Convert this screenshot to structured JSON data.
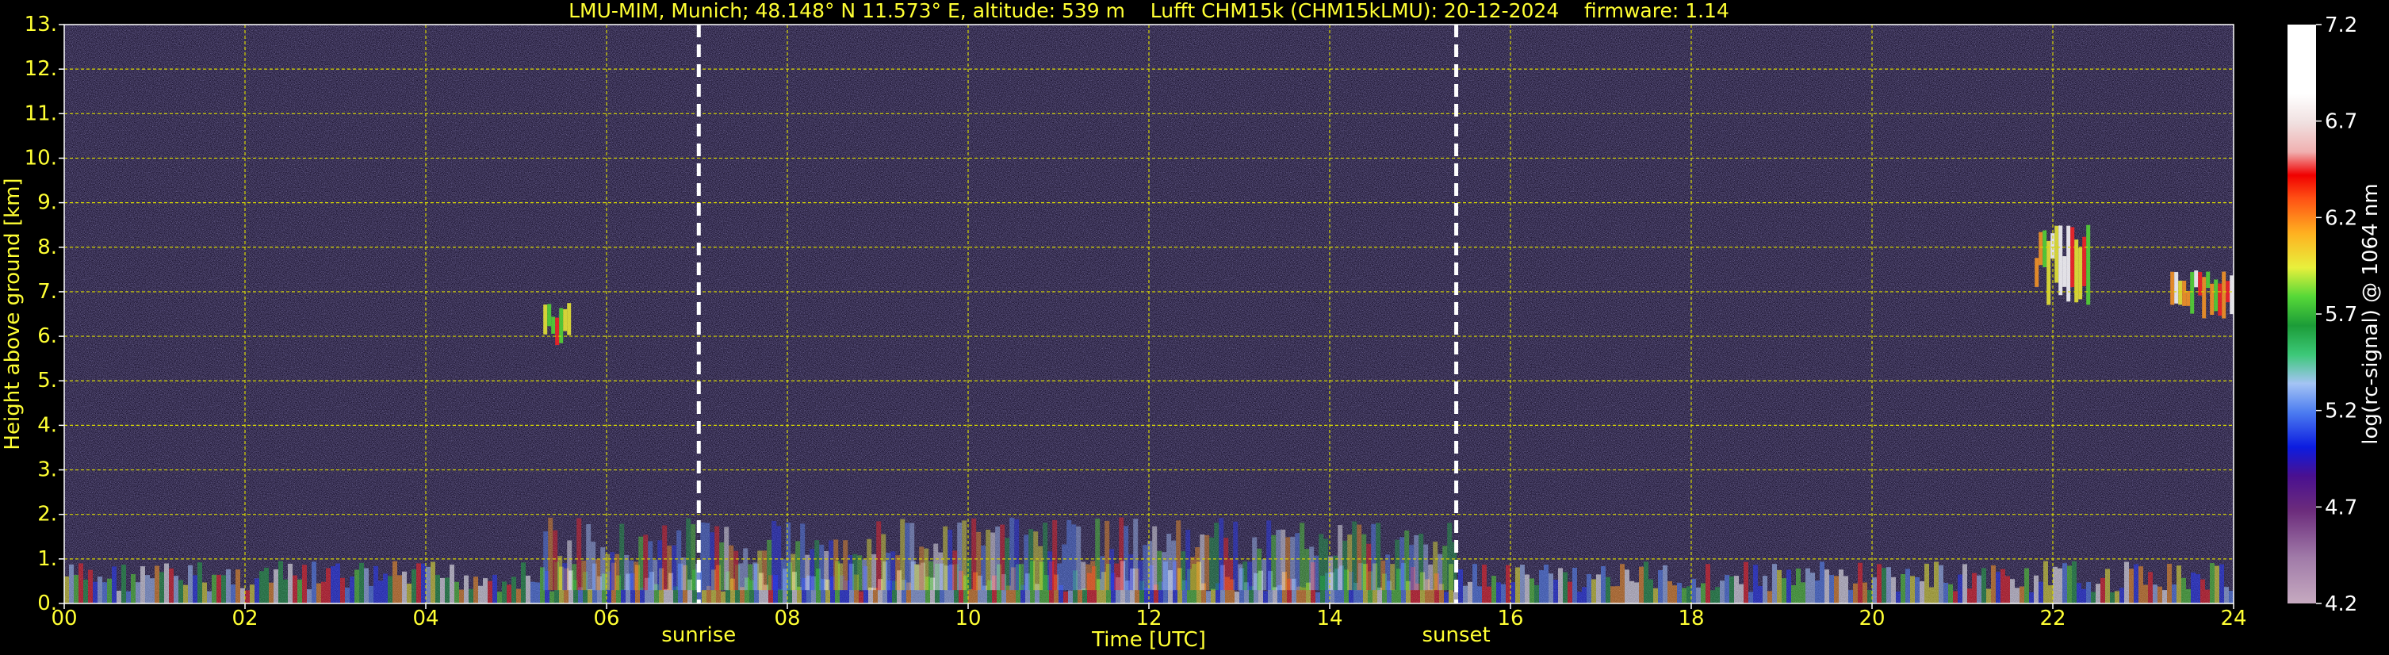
{
  "chart_data": {
    "type": "heatmap",
    "title": "LMU-MIM, Munich; 48.148° N 11.573° E, altitude: 539 m    Lufft CHM15k (CHM15kLMU): 20-12-2024    firmware: 1.14",
    "xlabel": "Time [UTC]",
    "ylabel": "Height above ground [km]",
    "x_range": [
      0,
      24
    ],
    "y_range": [
      0,
      13
    ],
    "x_ticks": [
      "00",
      "02",
      "04",
      "06",
      "08",
      "10",
      "12",
      "14",
      "16",
      "18",
      "20",
      "22",
      "24"
    ],
    "y_ticks": [
      "0.",
      "1.",
      "2.",
      "3.",
      "4.",
      "5.",
      "6.",
      "7.",
      "8.",
      "9.",
      "10.",
      "11.",
      "12.",
      "13."
    ],
    "grid": true,
    "events": [
      {
        "label": "sunrise",
        "time": 7.02
      },
      {
        "label": "sunset",
        "time": 15.4
      }
    ],
    "colorbar": {
      "label": "log(rc-signal) @ 1064 nm",
      "range": [
        4.2,
        7.2
      ],
      "ticks": [
        "4.2",
        "4.7",
        "5.2",
        "5.7",
        "6.2",
        "6.7",
        "7.2"
      ]
    },
    "features": [
      {
        "kind": "boundary_layer",
        "start": 0.0,
        "end": 24.0,
        "top_km": 0.6
      },
      {
        "kind": "aerosol_layer",
        "start": 5.3,
        "end": 15.4,
        "top_km": 1.4
      },
      {
        "kind": "cloud",
        "start": 5.3,
        "end": 5.6,
        "base_km": 5.8,
        "top_km": 6.8
      },
      {
        "kind": "cloud",
        "start": 21.8,
        "end": 22.4,
        "base_km": 6.7,
        "top_km": 8.5
      },
      {
        "kind": "cloud",
        "start": 23.3,
        "end": 24.0,
        "base_km": 6.4,
        "top_km": 7.5
      }
    ]
  }
}
